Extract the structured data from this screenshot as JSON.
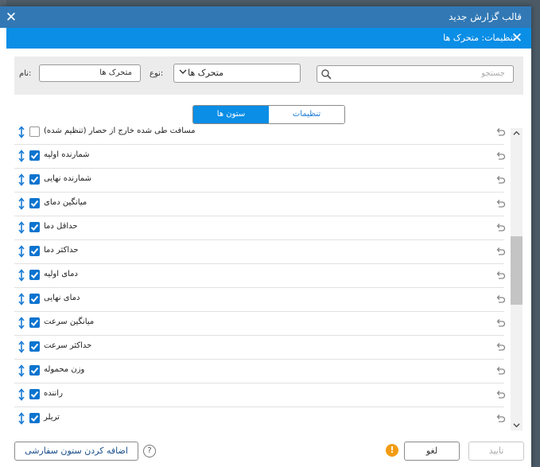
{
  "window": {
    "title": "قالب گزارش جدید",
    "subtitle": "تنظیمات: متحرک ها"
  },
  "toolbar": {
    "search_placeholder": "جستجو",
    "type_label": "نوع:",
    "type_value": "متحرک ها",
    "name_label": "نام:",
    "name_value": "متحرک ها"
  },
  "tabs": {
    "settings": "تنظیمات",
    "columns": "ستون ها",
    "active": "columns"
  },
  "columns": [
    {
      "label": "مسافت طی شده خارج از حصار (تنظیم شده)",
      "checked": false
    },
    {
      "label": "شمارنده اولیه",
      "checked": true
    },
    {
      "label": "شمارنده نهایی",
      "checked": true
    },
    {
      "label": "میانگین دمای",
      "checked": true
    },
    {
      "label": "حداقل دما",
      "checked": true
    },
    {
      "label": "حداکثر دما",
      "checked": true
    },
    {
      "label": "دمای اولیه",
      "checked": true
    },
    {
      "label": "دمای نهایی",
      "checked": true
    },
    {
      "label": "میانگین سرعت",
      "checked": true
    },
    {
      "label": "حداکثر سرعت",
      "checked": true
    },
    {
      "label": "وزن محموله",
      "checked": true
    },
    {
      "label": "راننده",
      "checked": true
    },
    {
      "label": "تریلر",
      "checked": true
    }
  ],
  "footer": {
    "add_custom_column": "اضافه کردن ستون سفارشی",
    "help": "?",
    "warning": "!",
    "cancel": "لغو",
    "confirm": "تایید"
  },
  "colors": {
    "outer_title_bg": "#3178b5",
    "inner_title_bg": "#0a8ee6",
    "accent": "#0b74cf",
    "warning": "#f39c12"
  },
  "icons": {
    "close": "close-icon",
    "search": "search-icon",
    "chevron": "chevron-down-icon",
    "drag": "drag-handle-icon",
    "reset": "undo-icon"
  }
}
